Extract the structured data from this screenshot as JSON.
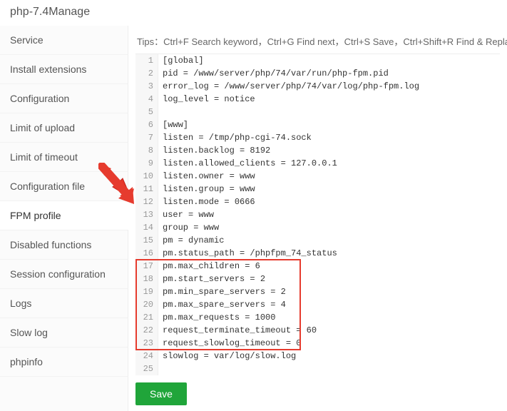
{
  "title": "php-7.4Manage",
  "sidebar": {
    "items": [
      {
        "label": "Service"
      },
      {
        "label": "Install extensions"
      },
      {
        "label": "Configuration"
      },
      {
        "label": "Limit of upload"
      },
      {
        "label": "Limit of timeout"
      },
      {
        "label": "Configuration file"
      },
      {
        "label": "FPM profile"
      },
      {
        "label": "Disabled functions"
      },
      {
        "label": "Session configuration"
      },
      {
        "label": "Logs"
      },
      {
        "label": "Slow log"
      },
      {
        "label": "phpinfo"
      }
    ],
    "active_index": 6
  },
  "tips": "Tips：Ctrl+F Search keyword，Ctrl+G Find next，Ctrl+S Save，Ctrl+Shift+R Find & Replace!",
  "editor": {
    "lines": [
      "[global]",
      "pid = /www/server/php/74/var/run/php-fpm.pid",
      "error_log = /www/server/php/74/var/log/php-fpm.log",
      "log_level = notice",
      "",
      "[www]",
      "listen = /tmp/php-cgi-74.sock",
      "listen.backlog = 8192",
      "listen.allowed_clients = 127.0.0.1",
      "listen.owner = www",
      "listen.group = www",
      "listen.mode = 0666",
      "user = www",
      "group = www",
      "pm = dynamic",
      "pm.status_path = /phpfpm_74_status",
      "pm.max_children = 6",
      "pm.start_servers = 2",
      "pm.min_spare_servers = 2",
      "pm.max_spare_servers = 4",
      "pm.max_requests = 1000",
      "request_terminate_timeout = 60",
      "request_slowlog_timeout = 0",
      "slowlog = var/log/slow.log",
      ""
    ],
    "highlight_start_line": 17,
    "highlight_end_line": 23
  },
  "save_label": "Save"
}
